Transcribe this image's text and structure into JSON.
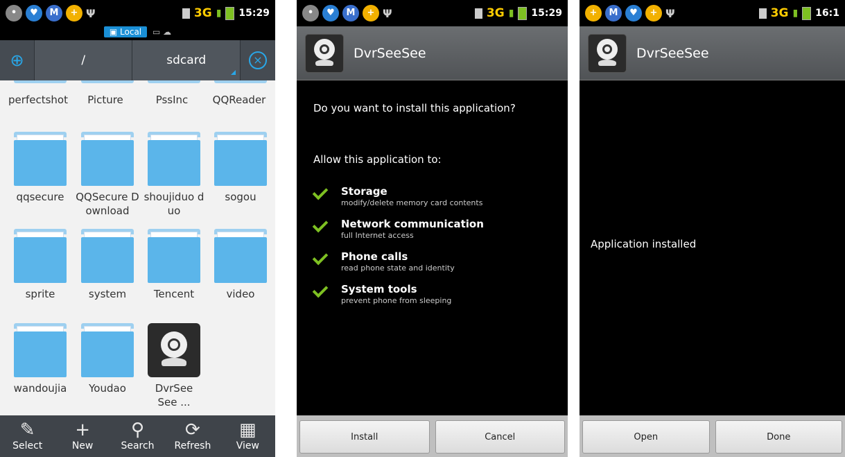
{
  "colors": {
    "accent_blue": "#29a7e8",
    "folder_blue": "#5bb5ea",
    "check_green": "#7ec022",
    "network_yellow": "#ffcc00"
  },
  "screen1": {
    "status": {
      "network": "3G",
      "time": "15:29"
    },
    "location_tab": "Local",
    "path": {
      "root": "/",
      "current": "sdcard"
    },
    "items": [
      {
        "name": "perfectshot",
        "kind": "folder"
      },
      {
        "name": "Picture",
        "kind": "folder"
      },
      {
        "name": "PssInc",
        "kind": "folder"
      },
      {
        "name": "QQReader",
        "kind": "folder"
      },
      {
        "name": "qqsecure",
        "kind": "folder"
      },
      {
        "name": "QQSecure Download",
        "kind": "folder"
      },
      {
        "name": "shoujiduo duo",
        "kind": "folder"
      },
      {
        "name": "sogou",
        "kind": "folder"
      },
      {
        "name": "sprite",
        "kind": "folder"
      },
      {
        "name": "system",
        "kind": "folder"
      },
      {
        "name": "Tencent",
        "kind": "folder"
      },
      {
        "name": "video",
        "kind": "folder"
      },
      {
        "name": "wandoujia",
        "kind": "folder"
      },
      {
        "name": "Youdao",
        "kind": "folder"
      },
      {
        "name": "DvrSeeSee ...",
        "kind": "apk"
      }
    ],
    "toolbar": [
      {
        "label": "Select",
        "icon": "select-icon"
      },
      {
        "label": "New",
        "icon": "plus-icon"
      },
      {
        "label": "Search",
        "icon": "search-icon"
      },
      {
        "label": "Refresh",
        "icon": "refresh-icon"
      },
      {
        "label": "View",
        "icon": "grid-view-icon"
      }
    ]
  },
  "screen2": {
    "status": {
      "network": "3G",
      "time": "15:29"
    },
    "title": "DvrSeeSee",
    "question": "Do you want to install this application?",
    "allow_heading": "Allow this application to:",
    "permissions": [
      {
        "title": "Storage",
        "desc": "modify/delete memory card contents"
      },
      {
        "title": "Network communication",
        "desc": "full Internet access"
      },
      {
        "title": "Phone calls",
        "desc": "read phone state and identity"
      },
      {
        "title": "System tools",
        "desc": "prevent phone from sleeping"
      }
    ],
    "buttons": {
      "install": "Install",
      "cancel": "Cancel"
    }
  },
  "screen3": {
    "status": {
      "network": "3G",
      "time": "16:1"
    },
    "title": "DvrSeeSee",
    "message": "Application installed",
    "buttons": {
      "open": "Open",
      "done": "Done"
    }
  }
}
